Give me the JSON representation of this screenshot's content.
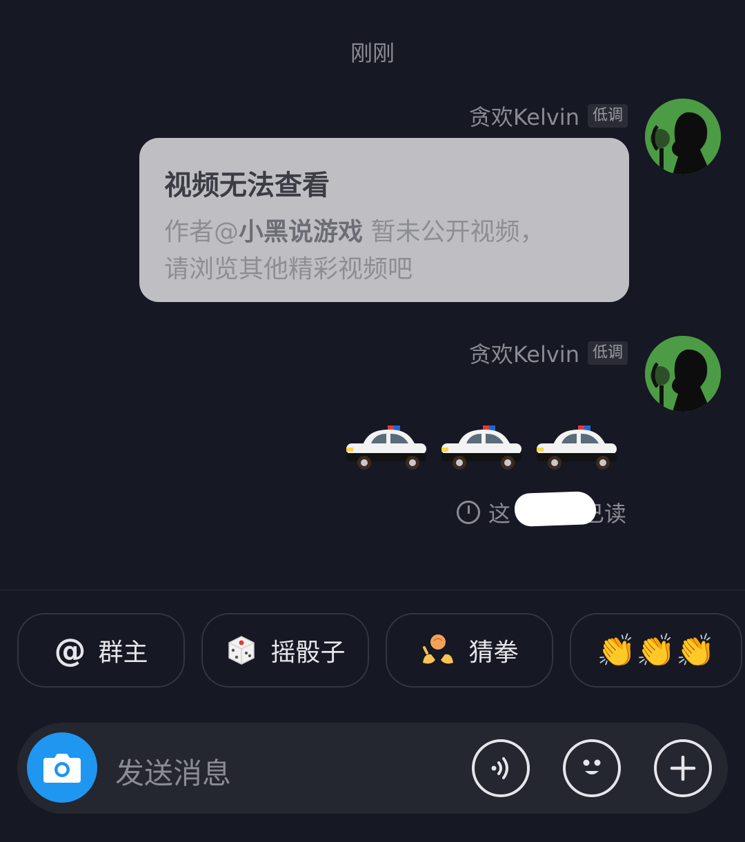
{
  "timestamp": "刚刚",
  "messages": [
    {
      "sender": "贪欢Kelvin",
      "tag": "低调",
      "card": {
        "title": "视频无法查看",
        "body_prefix": "作者@",
        "author": "小黑说游戏",
        "body_suffix": " 暂未公开视频，",
        "body_line2": "请浏览其他精彩视频吧"
      }
    },
    {
      "sender": "贪欢Kelvin",
      "tag": "低调",
      "emoji_icon": "police-car-icon",
      "emoji_count": 3
    }
  ],
  "read_status": {
    "prefix": "这",
    "suffix": "已读"
  },
  "quick_actions": [
    {
      "icon": "at-icon",
      "glyph": "@",
      "label": "群主"
    },
    {
      "icon": "dice-icon",
      "label": "摇骰子"
    },
    {
      "icon": "rock-paper-scissors-icon",
      "label": "猜拳"
    },
    {
      "icon": "clapping-hands-icon",
      "glyph": "👏👏👏"
    }
  ],
  "input": {
    "placeholder": "发送消息"
  },
  "colors": {
    "background": "#161823",
    "camera_button": "#1f96f0",
    "card": "#bfbfc3"
  }
}
